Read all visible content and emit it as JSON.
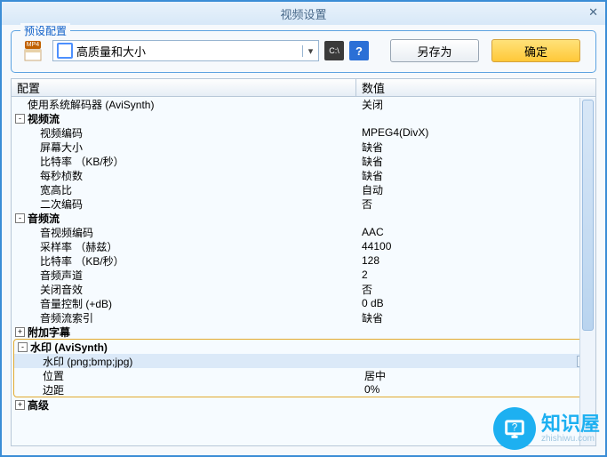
{
  "title": "视频设置",
  "preset": {
    "legend": "预设配置",
    "format_badge": "MP4",
    "selected": "高质量和大小",
    "cmd_icon": "C:\\",
    "help": "?",
    "save_as": "另存为",
    "ok": "确定"
  },
  "columns": {
    "config": "配置",
    "value": "数值"
  },
  "rows": [
    {
      "type": "item",
      "indent": 1,
      "label": "使用系统解码器 (AviSynth)",
      "value": "关闭"
    },
    {
      "type": "section",
      "indent": 0,
      "toggle": "-",
      "label": "视频流"
    },
    {
      "type": "item",
      "indent": 2,
      "label": "视频编码",
      "value": "MPEG4(DivX)"
    },
    {
      "type": "item",
      "indent": 2,
      "label": "屏幕大小",
      "value": "缺省"
    },
    {
      "type": "item",
      "indent": 2,
      "label": "比特率 （KB/秒）",
      "value": "缺省"
    },
    {
      "type": "item",
      "indent": 2,
      "label": "每秒桢数",
      "value": "缺省"
    },
    {
      "type": "item",
      "indent": 2,
      "label": "宽高比",
      "value": "自动"
    },
    {
      "type": "item",
      "indent": 2,
      "label": "二次编码",
      "value": "否"
    },
    {
      "type": "section",
      "indent": 0,
      "toggle": "-",
      "label": "音频流"
    },
    {
      "type": "item",
      "indent": 2,
      "label": "音视频编码",
      "value": "AAC"
    },
    {
      "type": "item",
      "indent": 2,
      "label": "采样率 （赫兹）",
      "value": "44100"
    },
    {
      "type": "item",
      "indent": 2,
      "label": "比特率 （KB/秒）",
      "value": "128"
    },
    {
      "type": "item",
      "indent": 2,
      "label": "音频声道",
      "value": "2"
    },
    {
      "type": "item",
      "indent": 2,
      "label": "关闭音效",
      "value": "否"
    },
    {
      "type": "item",
      "indent": 2,
      "label": "音量控制 (+dB)",
      "value": "0 dB"
    },
    {
      "type": "item",
      "indent": 2,
      "label": "音频流索引",
      "value": "缺省"
    },
    {
      "type": "section",
      "indent": 0,
      "toggle": "+",
      "label": "附加字幕"
    },
    {
      "type": "section",
      "indent": 0,
      "toggle": "-",
      "label": "水印 (AviSynth)",
      "hlstart": true
    },
    {
      "type": "item",
      "indent": 2,
      "label": "水印 (png;bmp;jpg)",
      "value": "",
      "selected": true
    },
    {
      "type": "item",
      "indent": 2,
      "label": "位置",
      "value": "居中"
    },
    {
      "type": "item",
      "indent": 2,
      "label": "边距",
      "value": "0%",
      "hlend": true
    },
    {
      "type": "section",
      "indent": 0,
      "toggle": "+",
      "label": "高级"
    }
  ],
  "ellipsis": "..",
  "watermark": {
    "text": "知识屋",
    "sub": "zhishiwu.com"
  }
}
